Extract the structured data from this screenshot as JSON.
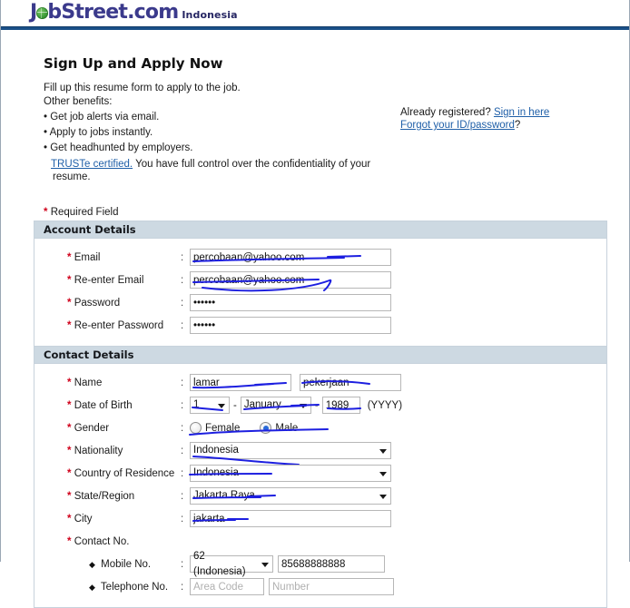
{
  "header": {
    "logo_text_1": "J",
    "logo_globe": "globe-o",
    "logo_text_2": "bStreet.com",
    "logo_country": "Indonesia"
  },
  "intro": {
    "title": "Sign Up and Apply Now",
    "line1": "Fill up this resume form to apply to the job.",
    "line2": "Other benefits:",
    "bullet1": "• Get job alerts via email.",
    "bullet2": "• Apply to jobs instantly.",
    "bullet3": "• Get headhunted by employers.",
    "truste_link": "TRUSTe certified.",
    "truste_text": " You have full control over the confidentiality of your resume."
  },
  "signin": {
    "already_registered": "Already registered?",
    "sign_in_link": "Sign in here",
    "forgot_link": "Forgot your ID/password",
    "forgot_suffix": "?"
  },
  "required_note": {
    "star": "*",
    "text": "Required Field"
  },
  "account_details": {
    "section_title": "Account Details",
    "fields": [
      {
        "label": "Email",
        "value": "percobaan@yahoo.com"
      },
      {
        "label": "Re-enter Email",
        "value": "percobaan@yahoo.com"
      },
      {
        "label": "Password",
        "value": "••••••"
      },
      {
        "label": "Re-enter Password",
        "value": "••••••"
      }
    ]
  },
  "contact_details": {
    "section_title": "Contact Details",
    "name": {
      "label": "Name",
      "first_value": "lamar",
      "last_value": "pekerjaan"
    },
    "dob": {
      "label": "Date of Birth",
      "day": "1",
      "month": "January",
      "year": "1989",
      "hint": "(YYYY)",
      "separator": "-"
    },
    "gender": {
      "label": "Gender",
      "female_label": "Female",
      "male_label": "Male",
      "selected": "Male"
    },
    "nationality": {
      "label": "Nationality",
      "value": "Indonesia"
    },
    "country_of_residence": {
      "label": "Country of Residence",
      "value": "Indonesia"
    },
    "state_region": {
      "label": "State/Region",
      "value": "Jakarta Raya"
    },
    "city": {
      "label": "City",
      "value": "jakarta"
    },
    "contact_no": {
      "label": "Contact No.",
      "mobile_label": "Mobile No.",
      "mobile_cc": "62 (Indonesia)",
      "mobile_number": "85688888888",
      "telephone_label": "Telephone No.",
      "area_code_placeholder": "Area Code",
      "number_placeholder": "Number"
    }
  },
  "colors": {
    "brand_blue": "#3b3a8c",
    "header_rule": "#1a4f87",
    "section_bar": "#cdd9e2",
    "link": "#1f5fa8",
    "required_star": "#d0021b",
    "annotation": "#1d1fe0"
  }
}
